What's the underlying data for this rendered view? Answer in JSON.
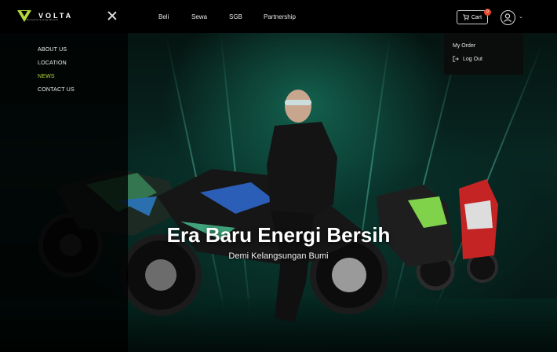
{
  "brand": {
    "name": "VOLTA",
    "tagline": "Exclusive Energy Benefit"
  },
  "nav": {
    "items": [
      "Beli",
      "Sewa",
      "SGB",
      "Partnership"
    ]
  },
  "cart": {
    "label": "Cart",
    "count": "0"
  },
  "side_menu": {
    "items": [
      {
        "label": "ABOUT US",
        "active": false
      },
      {
        "label": "LOCATION",
        "active": false
      },
      {
        "label": "NEWS",
        "active": true
      },
      {
        "label": "CONTACT US",
        "active": false
      }
    ]
  },
  "user_dropdown": {
    "items": [
      "My Order",
      "Log Out"
    ]
  },
  "hero": {
    "title": "Era Baru Energi Bersih",
    "subtitle": "Demi Kelangsungan Bumi"
  },
  "colors": {
    "accent": "#b6d83a",
    "badge": "#e8472b",
    "background": "#05120f"
  }
}
